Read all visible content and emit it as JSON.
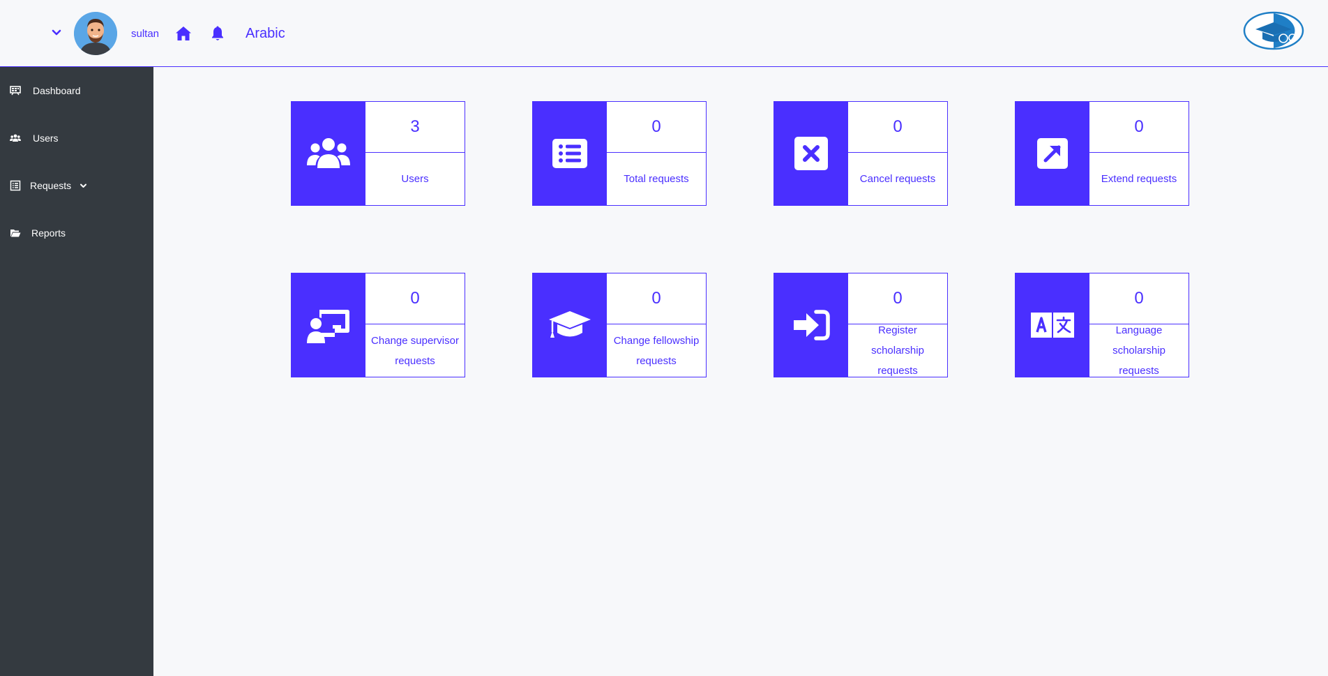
{
  "header": {
    "username": "sultan",
    "language_link": "Arabic"
  },
  "sidebar": {
    "items": [
      {
        "label": "Dashboard",
        "icon": "dashboard-icon"
      },
      {
        "label": "Users",
        "icon": "users-icon"
      },
      {
        "label": "Requests",
        "icon": "list-icon"
      },
      {
        "label": "Reports",
        "icon": "folder-open-icon"
      }
    ]
  },
  "cards": [
    {
      "value": "3",
      "label": "Users",
      "icon": "users-icon"
    },
    {
      "value": "0",
      "label": "Total requests",
      "icon": "list-icon"
    },
    {
      "value": "0",
      "label": "Cancel requests",
      "icon": "cancel-icon"
    },
    {
      "value": "0",
      "label": "Extend requests",
      "icon": "extend-arrow-icon"
    },
    {
      "value": "0",
      "label": "Change supervisor requests",
      "icon": "supervisor-icon"
    },
    {
      "value": "0",
      "label": "Change fellowship requests",
      "icon": "graduation-cap-icon"
    },
    {
      "value": "0",
      "label": "Register scholarship requests",
      "icon": "sign-in-icon"
    },
    {
      "value": "0",
      "label": "Language scholarship requests",
      "icon": "language-icon"
    }
  ],
  "colors": {
    "accent": "#4a2fff",
    "sidebar_bg": "#343a40",
    "page_bg": "#f7f8fa"
  }
}
